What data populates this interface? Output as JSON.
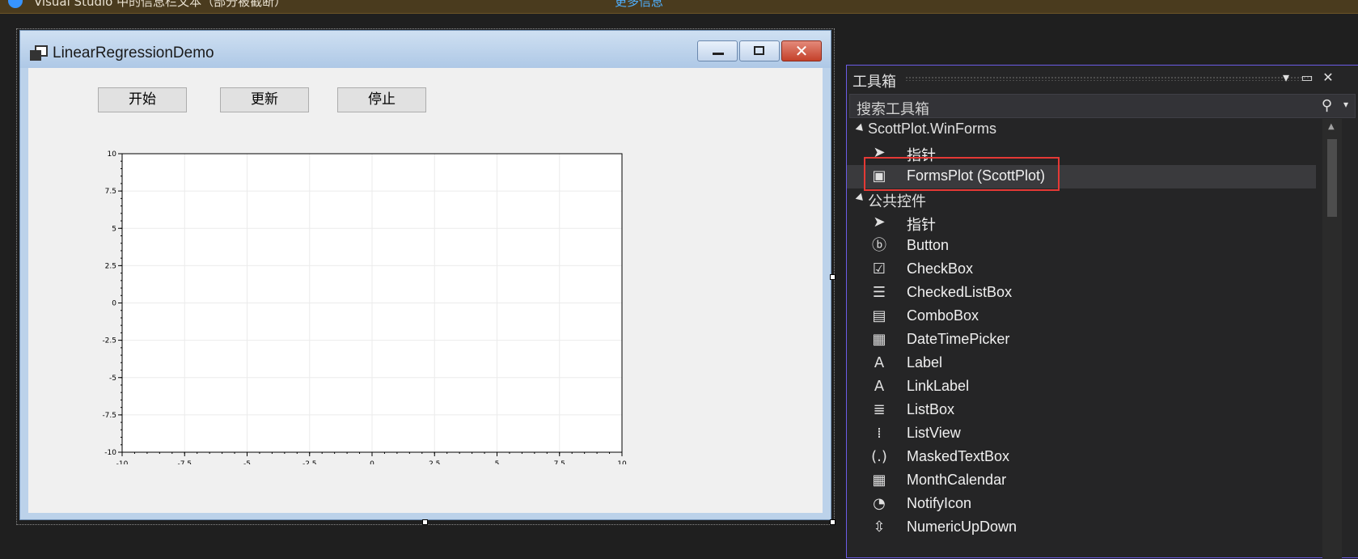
{
  "infobar": {
    "text": "Visual Studio 中的信息栏文本（部分被截断）",
    "link": "更多信息"
  },
  "form": {
    "title": "LinearRegressionDemo",
    "buttons": {
      "start": "开始",
      "update": "更新",
      "stop": "停止"
    }
  },
  "chart_data": {
    "type": "scatter",
    "title": "",
    "xlabel": "",
    "ylabel": "",
    "xlim": [
      -10,
      10
    ],
    "ylim": [
      -10,
      10
    ],
    "x_ticks": [
      "-10",
      "-7.5",
      "-5",
      "-2.5",
      "0",
      "2.5",
      "5",
      "7.5",
      "10"
    ],
    "y_ticks": [
      "10",
      "7.5",
      "5",
      "2.5",
      "0",
      "-2.5",
      "-5",
      "-7.5",
      "-10"
    ],
    "grid": true,
    "series": []
  },
  "toolbox": {
    "title": "工具箱",
    "search_placeholder": "搜索工具箱",
    "groups": [
      {
        "label": "ScottPlot.WinForms",
        "items": [
          {
            "label": "指针",
            "icon": "pointer-icon"
          },
          {
            "label": "FormsPlot (ScottPlot)",
            "icon": "formsplot-icon",
            "selected": true
          }
        ]
      },
      {
        "label": "公共控件",
        "items": [
          {
            "label": "指针",
            "icon": "pointer-icon"
          },
          {
            "label": "Button",
            "icon": "button-icon"
          },
          {
            "label": "CheckBox",
            "icon": "checkbox-icon"
          },
          {
            "label": "CheckedListBox",
            "icon": "checkedlistbox-icon"
          },
          {
            "label": "ComboBox",
            "icon": "combobox-icon"
          },
          {
            "label": "DateTimePicker",
            "icon": "datetimepicker-icon"
          },
          {
            "label": "Label",
            "icon": "label-icon"
          },
          {
            "label": "LinkLabel",
            "icon": "linklabel-icon"
          },
          {
            "label": "ListBox",
            "icon": "listbox-icon"
          },
          {
            "label": "ListView",
            "icon": "listview-icon"
          },
          {
            "label": "MaskedTextBox",
            "icon": "maskedtextbox-icon"
          },
          {
            "label": "MonthCalendar",
            "icon": "monthcalendar-icon"
          },
          {
            "label": "NotifyIcon",
            "icon": "notifyicon-icon"
          },
          {
            "label": "NumericUpDown",
            "icon": "numericupdown-icon"
          }
        ]
      }
    ]
  },
  "colors": {
    "accent": "#6c5ce7",
    "highlight": "#e53935"
  }
}
